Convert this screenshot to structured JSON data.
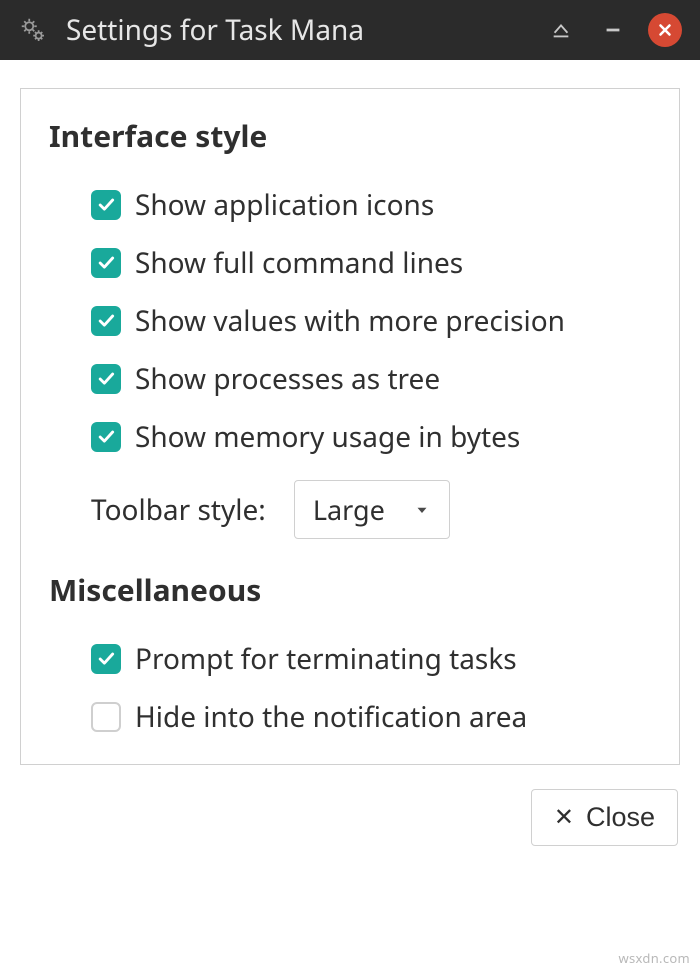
{
  "titlebar": {
    "title": "Settings for Task Mana"
  },
  "sections": {
    "interface": {
      "title": "Interface style",
      "options": {
        "show_app_icons": {
          "label": "Show application icons",
          "checked": true
        },
        "show_full_cmd": {
          "label": "Show full command lines",
          "checked": true
        },
        "show_more_precision": {
          "label": "Show values with more precision",
          "checked": true
        },
        "show_proc_tree": {
          "label": "Show processes as tree",
          "checked": true
        },
        "show_mem_bytes": {
          "label": "Show memory usage in bytes",
          "checked": true
        }
      },
      "toolbar_style": {
        "label": "Toolbar style:",
        "value": "Large"
      }
    },
    "misc": {
      "title": "Miscellaneous",
      "options": {
        "prompt_terminate": {
          "label": "Prompt for terminating tasks",
          "checked": true
        },
        "hide_notif": {
          "label": "Hide into the notification area",
          "checked": false
        }
      }
    }
  },
  "footer": {
    "close_label": "Close"
  },
  "watermark": "wsxdn.com"
}
